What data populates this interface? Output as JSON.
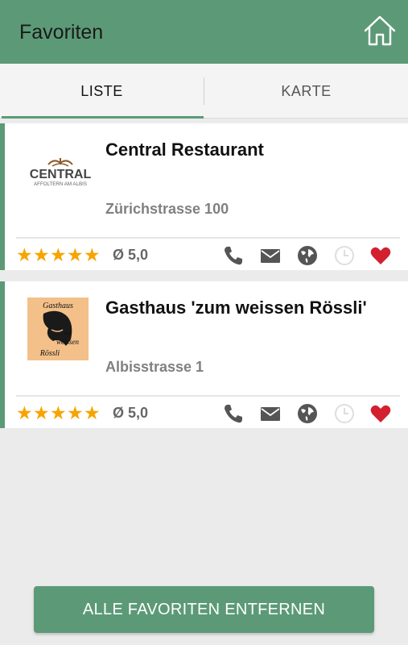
{
  "appbar": {
    "title": "Favoriten",
    "home_icon": "home-icon"
  },
  "tabs": [
    {
      "label": "LISTE",
      "active": true
    },
    {
      "label": "KARTE",
      "active": false
    }
  ],
  "favorites": [
    {
      "name": "Central Restaurant",
      "address": "Zürichstrasse 100",
      "rating": "Ø 5,0",
      "stars": 5,
      "logo": {
        "word": "CENTRAL",
        "sub": "AFFOLTERN AM ALBIS"
      },
      "favorite": true
    },
    {
      "name": "Gasthaus 'zum weissen Rössli'",
      "address": "Albisstrasse 1",
      "rating": "Ø 5,0",
      "stars": 5,
      "logo": {
        "line1": "Gasthaus",
        "line2": "zum",
        "line3": "weissen",
        "line4": "Rössli"
      },
      "favorite": true
    }
  ],
  "actions": [
    "phone-icon",
    "mail-icon",
    "globe-icon",
    "clock-icon",
    "heart-icon"
  ],
  "colors": {
    "accent": "#5c9a77",
    "star": "#f7a400",
    "heart": "#d2202f",
    "icon": "#555555"
  },
  "remove_all_label": "ALLE FAVORITEN ENTFERNEN"
}
